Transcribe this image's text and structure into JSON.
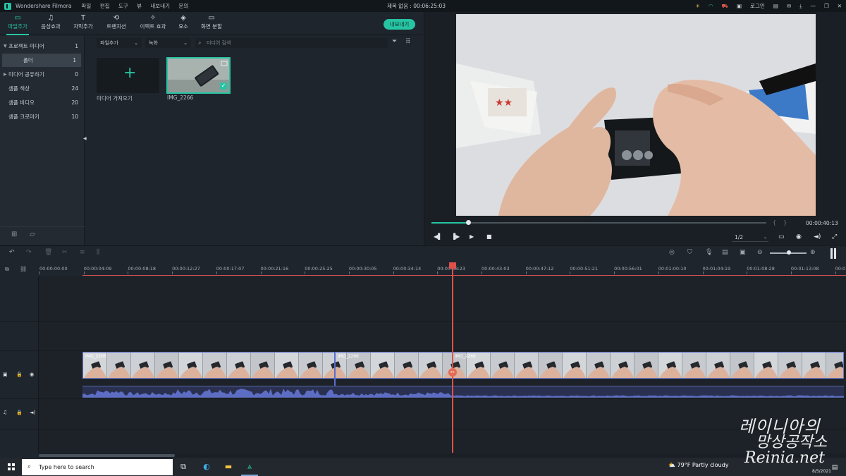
{
  "titlebar": {
    "app_name": "Wondershare Filmora",
    "menu": [
      "파일",
      "편집",
      "도구",
      "뷰",
      "내보내기",
      "문의"
    ],
    "project_title": "제목 없음 : 00:06:25:03",
    "login_label": "로그인"
  },
  "toolbar": {
    "tabs": [
      {
        "label": "파일추가",
        "icon": "folder-icon"
      },
      {
        "label": "음성효과",
        "icon": "music-icon"
      },
      {
        "label": "자막추가",
        "icon": "text-icon"
      },
      {
        "label": "트랜지션",
        "icon": "transition-icon"
      },
      {
        "label": "이펙트 효과",
        "icon": "effects-icon"
      },
      {
        "label": "요소",
        "icon": "elements-icon"
      },
      {
        "label": "화면 분할",
        "icon": "split-screen-icon"
      }
    ],
    "active_tab": "파일추가",
    "export_label": "내보내기"
  },
  "library": {
    "tree": [
      {
        "label": "프로젝트 미디어",
        "count": "1",
        "expanded": true
      },
      {
        "label": "폴더",
        "count": "1",
        "selected": true
      },
      {
        "label": "미디어 공유하기",
        "count": "0",
        "expanded": false
      },
      {
        "label": "샘플 색상",
        "count": "24"
      },
      {
        "label": "샘플 비디오",
        "count": "20"
      },
      {
        "label": "샘플 크로마키",
        "count": "10"
      }
    ],
    "dropdown_source": "파일추가",
    "dropdown_record": "녹화",
    "search_placeholder": "미디어 검색",
    "import_label": "미디어 가져오기",
    "clip_label": "IMG_2266"
  },
  "preview": {
    "progress": 0.11,
    "timecode": "00:00:40:13",
    "quality": "1/2"
  },
  "timeline": {
    "ruler": [
      "00:00:00:00",
      "00:00:04:09",
      "00:00:08:18",
      "00:00:12:27",
      "00:00:17:07",
      "00:00:21:16",
      "00:00:25:25",
      "00:00:30:05",
      "00:00:34:14",
      "00:00:38:23",
      "00:00:43:03",
      "00:00:47:12",
      "00:00:51:21",
      "00:00:56:01",
      "00:01:00:10",
      "00:01:04:19",
      "00:01:08:28",
      "00:01:13:08",
      "00:01"
    ],
    "clips": [
      "IMG_2266",
      "IMG_2266",
      "IMG_2266"
    ],
    "zoom": 0.52
  },
  "taskbar": {
    "search_placeholder": "Type here to search",
    "weather": "79°F  Partly cloudy",
    "date": "8/5/2021"
  },
  "watermark": {
    "line1": "레이니아의",
    "line2": "망상공작소",
    "line3": "Reinia.net"
  },
  "colors": {
    "accent": "#27c4a4",
    "playhead": "#e0504a",
    "clip_border": "#6a78c8"
  }
}
